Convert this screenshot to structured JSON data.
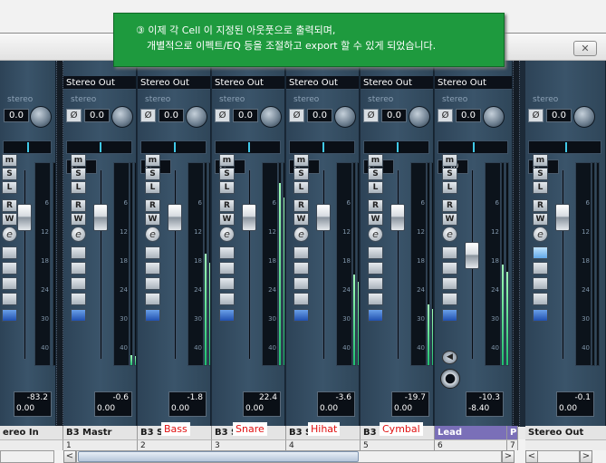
{
  "window": {
    "close_glyph": "✕"
  },
  "tooltip": {
    "line1": "③ 이제 각 Cell 이 지정된 아웃풋으로 출력되며,",
    "line2": "개별적으로 이펙트/EQ 등을 조절하고 export 할 수 있게 되었습니다."
  },
  "channels": [
    {
      "output": "",
      "pan": "",
      "peak": "-83.2",
      "vol": "0.00",
      "name": "ereo In",
      "num": ""
    },
    {
      "output": "Stereo Out",
      "pan": "C",
      "peak": "-0.6",
      "vol": "0.00",
      "name": "B3 Mastr",
      "num": "1"
    },
    {
      "output": "Stereo Out",
      "pan": "C",
      "peak": "-1.8",
      "vol": "0.00",
      "name": "B3 Si",
      "num": "2"
    },
    {
      "output": "Stereo Out",
      "pan": "C",
      "peak": "22.4",
      "vol": "0.00",
      "name": "B3 Si",
      "num": "3"
    },
    {
      "output": "Stereo Out",
      "pan": "C",
      "peak": "-3.6",
      "vol": "0.00",
      "name": "B3 Si",
      "num": "4"
    },
    {
      "output": "Stereo Out",
      "pan": "C",
      "peak": "-19.7",
      "vol": "0.00",
      "name": "B3 Si",
      "num": "5"
    },
    {
      "output": "Stereo Out",
      "pan": "L30",
      "peak": "-10.3",
      "vol": "-8.40",
      "name": "Lead",
      "num": "6"
    },
    {
      "output": "",
      "pan": "C",
      "peak": "-0.1",
      "vol": "0.00",
      "name": "Stereo Out",
      "num": ""
    }
  ],
  "labels": {
    "stereo": "stereo",
    "phase": "Ø",
    "gain": "0.0",
    "m": "m",
    "s": "S",
    "l": "L",
    "r": "R",
    "w": "W",
    "e": "e"
  },
  "cell_labels": [
    "Bass",
    "Snare",
    "Hihat",
    "Cymbal"
  ],
  "extra": {
    "p_label": "P",
    "num7": "7"
  },
  "scale_ticks": [
    "6",
    "12",
    "18",
    "24",
    "30",
    "40"
  ],
  "meters": [
    0.0,
    0.05,
    0.55,
    0.9,
    0.45,
    0.3,
    0.5,
    0.0
  ],
  "fader_levels": [
    0.82,
    0.82,
    0.82,
    0.82,
    0.82,
    0.82,
    0.62,
    0.82
  ],
  "scroll": {
    "left": "<",
    "right": ">"
  },
  "colors": {
    "lead_bg": "#7a6fb8",
    "mixer_bg": "#1c2a38",
    "tooltip_bg": "#1e9a3e"
  }
}
